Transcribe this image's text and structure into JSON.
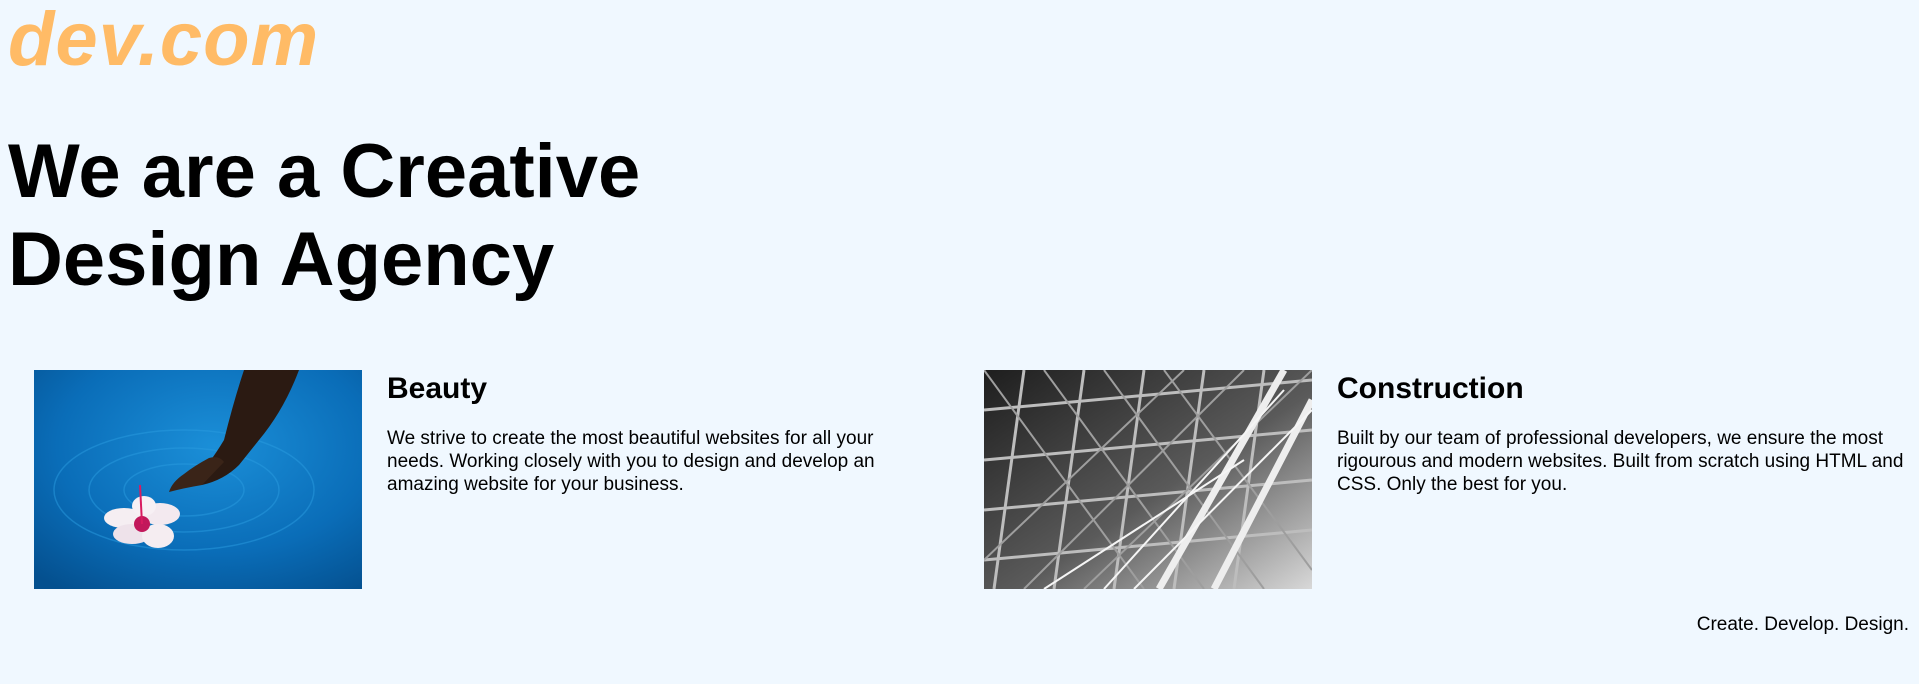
{
  "header": {
    "logo_text": "dev.com"
  },
  "hero": {
    "title": "We are a Creative Design Agency"
  },
  "cards": [
    {
      "title": "Beauty",
      "description": "We strive to create the most beautiful websites for all your needs. Working closely with you to design and develop an amazing website for your business."
    },
    {
      "title": "Construction",
      "description": "Built by our team of professional developers, we ensure the most rigourous and modern websites. Built from scratch using HTML and CSS. Only the best for you."
    }
  ],
  "footer": {
    "tagline": "Create. Develop. Design."
  },
  "colors": {
    "background": "#f0f8ff",
    "logo": "#ffbb66",
    "text": "#000000"
  }
}
